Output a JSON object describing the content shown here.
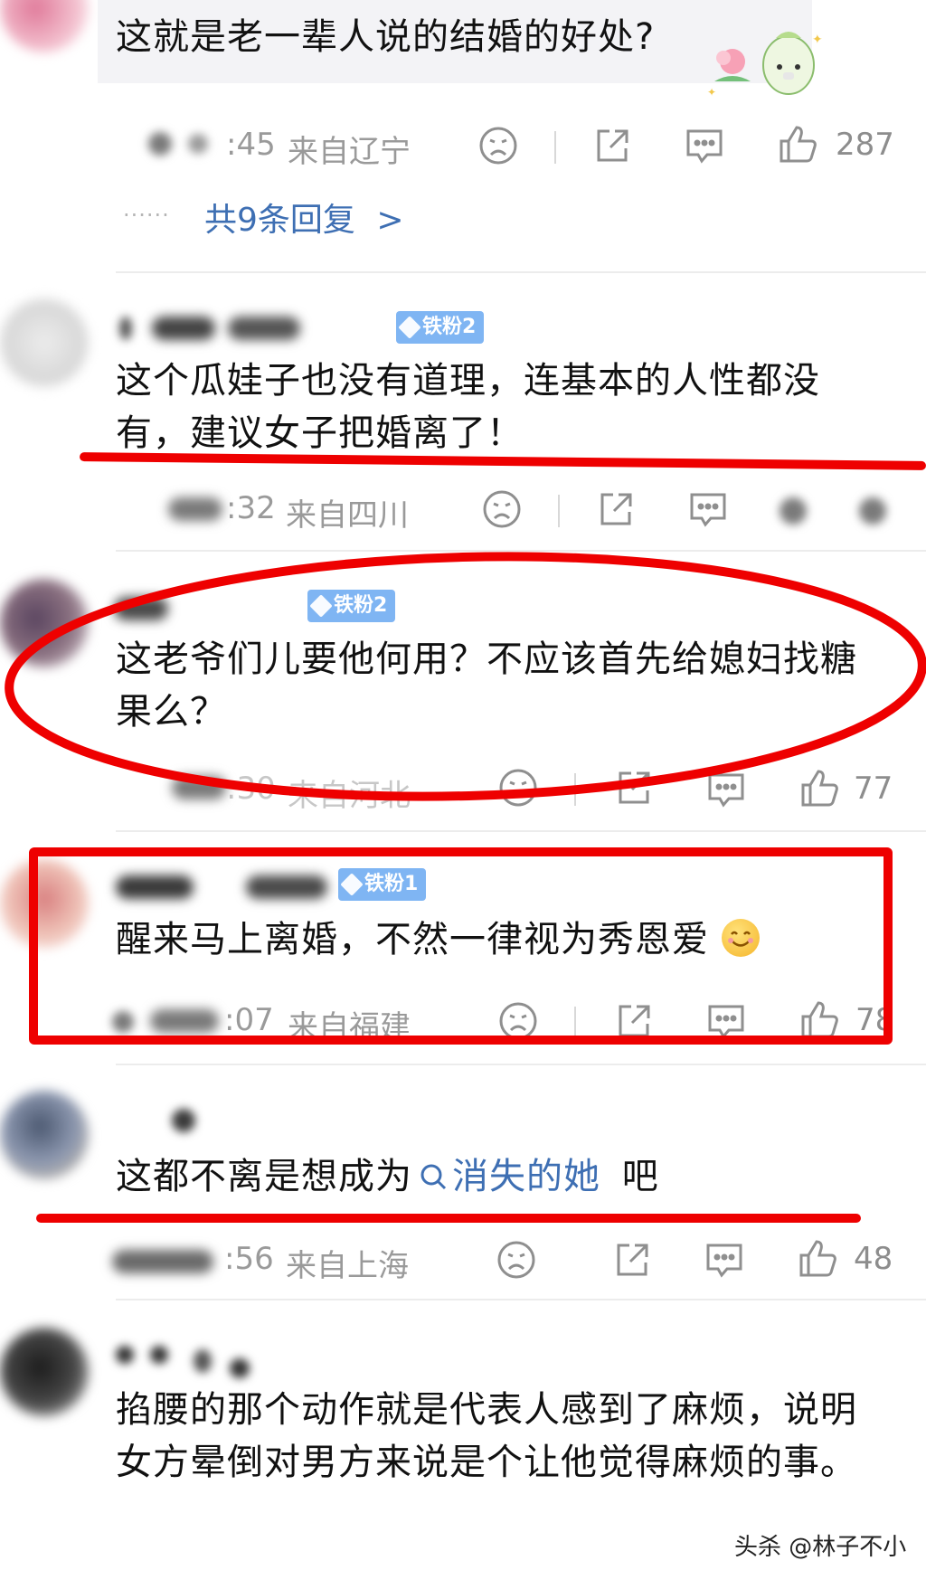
{
  "comments": [
    {
      "text": "这就是老一辈人说的结婚的好处?",
      "time": ":45",
      "location": "来自辽宁",
      "likes": "287",
      "replies": "共9条回复",
      "replies_chevron": ">",
      "replies_dots": "······"
    },
    {
      "badge": "铁粉2",
      "text": "这个瓜娃子也没有道理，连基本的人性都没有，建议女子把婚离了！",
      "time": ":32",
      "location": "来自四川"
    },
    {
      "badge": "铁粉2",
      "text": "这老爷们儿要他何用？不应该首先给媳妇找糖果么？",
      "time": ":30",
      "location": "来自河北",
      "likes": "77"
    },
    {
      "badge": "铁粉1",
      "text": "醒来马上离婚，不然一律视为秀恩爱",
      "time": ":07",
      "location": "来自福建",
      "likes": "78"
    },
    {
      "text_prefix": "这都不离是想成为",
      "link": "消失的她",
      "text_suffix": "吧",
      "time": ":56",
      "location": "来自上海",
      "likes": "48"
    },
    {
      "text": "掐腰的那个动作就是代表人感到了麻烦，说明女方晕倒对男方来说是个让他觉得麻烦的事。"
    }
  ],
  "watermark": "头杀 @林子不小",
  "colors": {
    "annotation_red": "#ee0000",
    "link_blue": "#3e6fb3",
    "badge_blue": "#7fb5f3"
  },
  "icons": [
    "dislike-face-icon",
    "share-icon",
    "comment-icon",
    "thumbs-up-icon",
    "search-icon",
    "smile-emoji-icon"
  ]
}
